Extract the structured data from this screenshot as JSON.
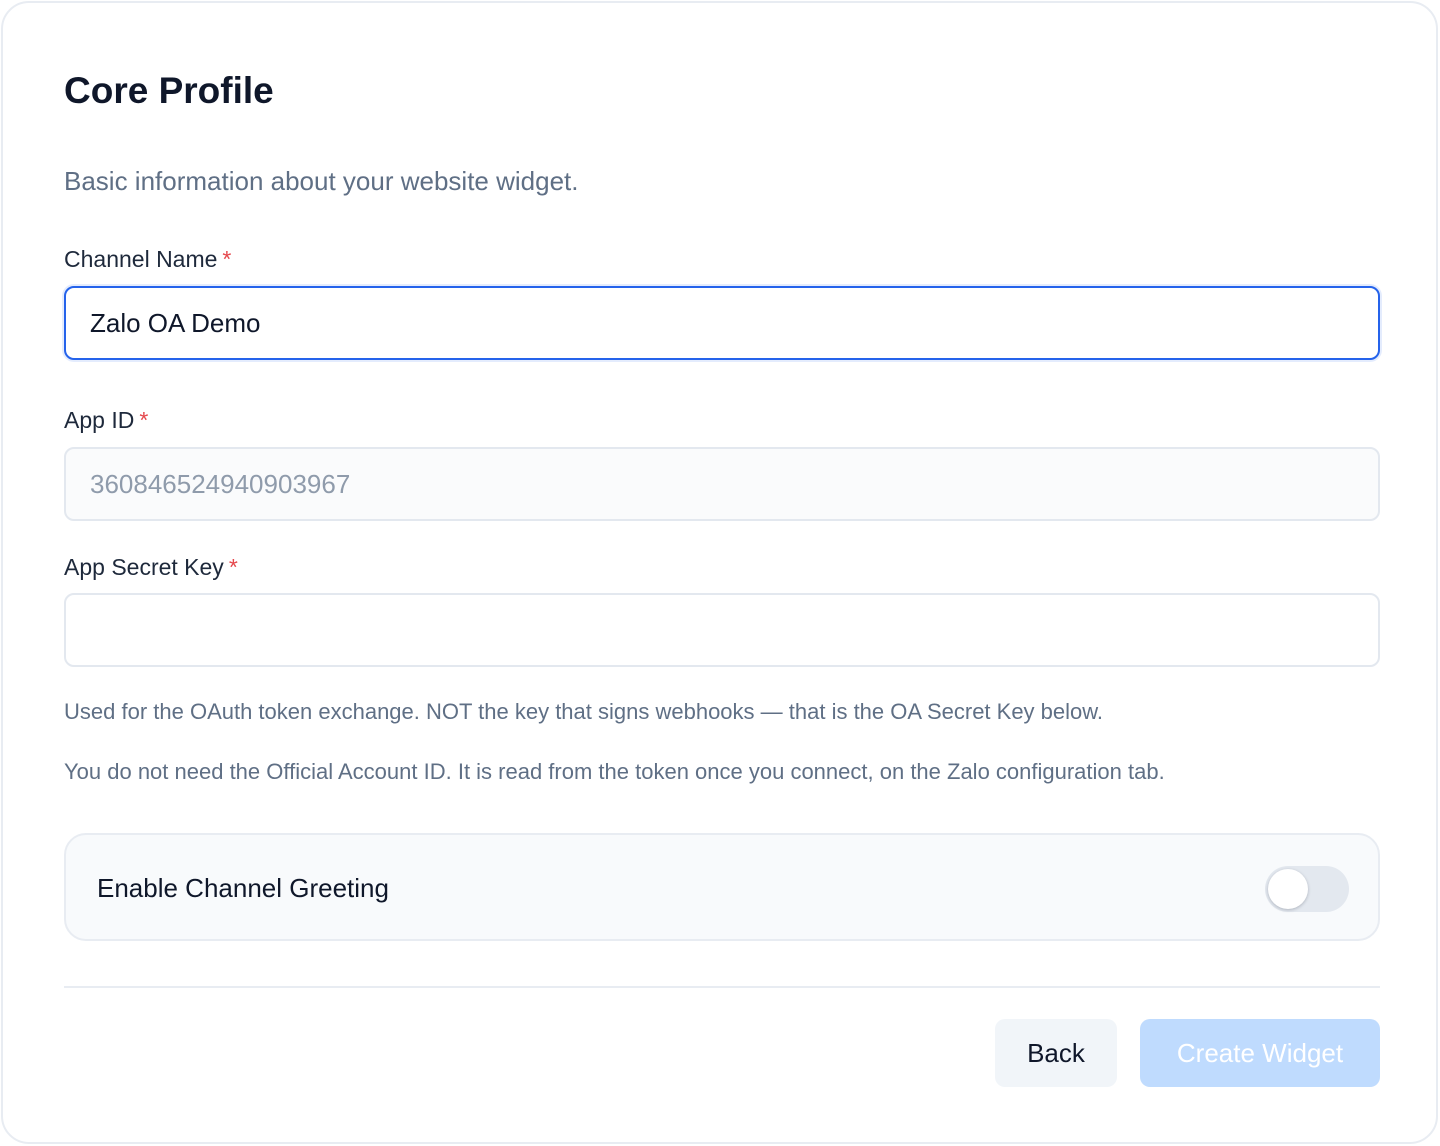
{
  "header": {
    "title": "Core Profile",
    "subtitle": "Basic information about your website widget."
  },
  "form": {
    "channel_name": {
      "label": "Channel Name",
      "required_mark": "*",
      "value": "Zalo OA Demo"
    },
    "app_id": {
      "label": "App ID",
      "required_mark": "*",
      "value": "3608465249409039​67",
      "placeholder": ""
    },
    "app_secret_key": {
      "label": "App Secret Key",
      "required_mark": "*",
      "value": "",
      "placeholder": ""
    },
    "help_text_1": "Used for the OAuth token exchange. NOT the key that signs webhooks — that is the OA Secret Key below.",
    "help_text_2": "You do not need the Official Account ID. It is read from the token once you connect, on the Zalo configuration tab.",
    "greeting": {
      "label": "Enable Channel Greeting",
      "enabled": false
    }
  },
  "footer": {
    "back_label": "Back",
    "create_label": "Create Widget"
  },
  "colors": {
    "accent": "#2563eb",
    "required": "#e5484d",
    "create_button_disabled": "#bfdbfe"
  }
}
